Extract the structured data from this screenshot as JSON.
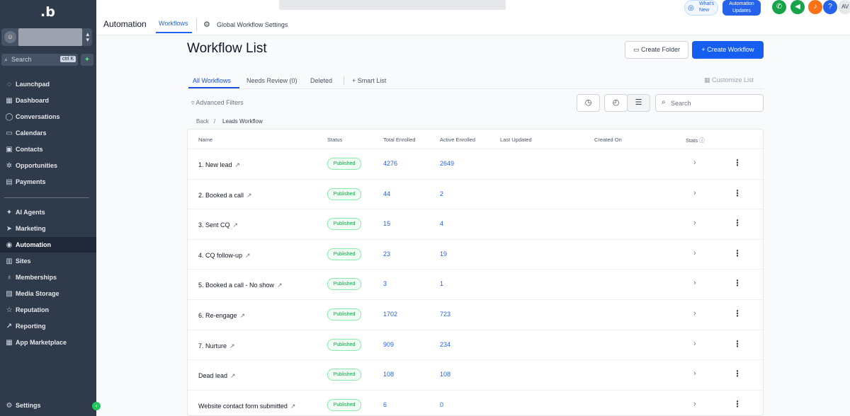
{
  "sidebar": {
    "logo": ".b",
    "avatar_icon": "user-icon",
    "search_placeholder": "Search",
    "search_shortcut": "ctrl K",
    "items": [
      {
        "label": "Launchpad",
        "icon": "launchpad-icon",
        "glyph": "◌"
      },
      {
        "label": "Dashboard",
        "icon": "dashboard-icon",
        "glyph": "▦"
      },
      {
        "label": "Conversations",
        "icon": "chat-icon",
        "glyph": "◯"
      },
      {
        "label": "Calendars",
        "icon": "calendar-icon",
        "glyph": "▭"
      },
      {
        "label": "Contacts",
        "icon": "contacts-icon",
        "glyph": "▣"
      },
      {
        "label": "Opportunities",
        "icon": "opportunities-icon",
        "glyph": "✲"
      },
      {
        "label": "Payments",
        "icon": "payments-icon",
        "glyph": "▤"
      },
      {
        "label": "AI Agents",
        "icon": "ai-agents-icon",
        "glyph": "✦"
      },
      {
        "label": "Marketing",
        "icon": "send-icon",
        "glyph": "➤"
      },
      {
        "label": "Automation",
        "icon": "automation-icon",
        "glyph": "◉"
      },
      {
        "label": "Sites",
        "icon": "sites-icon",
        "glyph": "▥"
      },
      {
        "label": "Memberships",
        "icon": "memberships-icon",
        "glyph": "♁"
      },
      {
        "label": "Media Storage",
        "icon": "image-icon",
        "glyph": "▧"
      },
      {
        "label": "Reputation",
        "icon": "star-icon",
        "glyph": "☆"
      },
      {
        "label": "Reporting",
        "icon": "chart-icon",
        "glyph": "↗"
      },
      {
        "label": "App Marketplace",
        "icon": "marketplace-icon",
        "glyph": "▦"
      }
    ],
    "active_item": "Automation",
    "settings_label": "Settings"
  },
  "topbar": {
    "title": "Automation",
    "tab_workflows": "Workflows",
    "tab_global_settings": "Global Workflow Settings",
    "whats_new": "What's New",
    "automation_updates": "Automation Updates",
    "avatar_initials": "AV",
    "quick_icons": [
      {
        "name": "phone-icon",
        "glyph": "✆",
        "color": "#16a34a"
      },
      {
        "name": "megaphone-icon",
        "glyph": "◀",
        "color": "#16a34a"
      },
      {
        "name": "bell-icon",
        "glyph": "♪",
        "color": "#f97316"
      },
      {
        "name": "help-icon",
        "glyph": "?",
        "color": "#2563eb"
      }
    ]
  },
  "main": {
    "page_title": "Workflow List",
    "create_folder": "Create Folder",
    "create_workflow": "Create Workflow",
    "tabs": [
      {
        "label": "All Workflows"
      },
      {
        "label": "Needs Review (0)"
      },
      {
        "label": "Deleted"
      },
      {
        "label": "Smart List"
      }
    ],
    "customize_list": "Customize List",
    "advanced_filters": "Advanced Filters",
    "search_placeholder": "Search",
    "breadcrumb": {
      "back": "Back",
      "separator": "/",
      "current": "Leads Workflow"
    },
    "columns": [
      "Name",
      "Status",
      "Total Enrolled",
      "Active Enrolled",
      "Last Updated",
      "Created On",
      "Stats"
    ],
    "rows": [
      {
        "name": "1. New lead",
        "status": "Published",
        "total": "4276",
        "active": "2649"
      },
      {
        "name": "2. Booked a call",
        "status": "Published",
        "total": "44",
        "active": "2"
      },
      {
        "name": "3. Sent CQ",
        "status": "Published",
        "total": "15",
        "active": "4"
      },
      {
        "name": "4. CQ follow-up",
        "status": "Published",
        "total": "23",
        "active": "19"
      },
      {
        "name": "5. Booked a call - No show",
        "status": "Published",
        "total": "3",
        "active": "1"
      },
      {
        "name": "6. Re-engage",
        "status": "Published",
        "total": "1702",
        "active": "723"
      },
      {
        "name": "7. Nurture",
        "status": "Published",
        "total": "909",
        "active": "234"
      },
      {
        "name": "Dead lead",
        "status": "Published",
        "total": "108",
        "active": "108"
      },
      {
        "name": "Website contact form submitted",
        "status": "Published",
        "total": "6",
        "active": "0"
      }
    ]
  },
  "colors": {
    "sidebar_bg": "#2f3a4a",
    "accent": "#155eef",
    "published": "#16a34a"
  }
}
